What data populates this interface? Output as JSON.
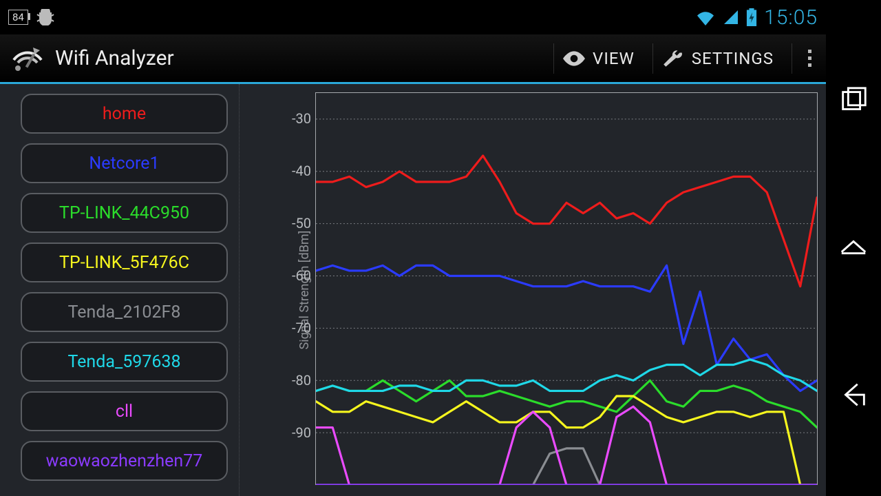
{
  "status": {
    "battery": "84",
    "clock": "15:05"
  },
  "app": {
    "title": "Wifi Analyzer"
  },
  "actions": {
    "view": "VIEW",
    "settings": "SETTINGS"
  },
  "networks": [
    {
      "name": "home",
      "color": "#ee1c1c"
    },
    {
      "name": "Netcore1",
      "color": "#2b3bff"
    },
    {
      "name": "TP-LINK_44C950",
      "color": "#2bdc2b"
    },
    {
      "name": "TP-LINK_5F476C",
      "color": "#f6f61e"
    },
    {
      "name": "Tenda_2102F8",
      "color": "#8a8d92"
    },
    {
      "name": "Tenda_597638",
      "color": "#1fd8e8"
    },
    {
      "name": "cll",
      "color": "#ea4bff"
    },
    {
      "name": "waowaozhenzhen77",
      "color": "#8b3bff"
    }
  ],
  "chart_data": {
    "type": "line",
    "ylabel": "Signal Strength [dBm]",
    "ylim": [
      -100,
      -25
    ],
    "yticks": [
      -30,
      -40,
      -50,
      -60,
      -70,
      -80,
      -90
    ],
    "x": [
      0,
      1,
      2,
      3,
      4,
      5,
      6,
      7,
      8,
      9,
      10,
      11,
      12,
      13,
      14,
      15,
      16,
      17,
      18,
      19,
      20,
      21,
      22,
      23,
      24,
      25,
      26,
      27,
      28,
      29,
      30
    ],
    "series": [
      {
        "name": "home",
        "color": "#ee1c1c",
        "values": [
          -42,
          -42,
          -41,
          -43,
          -42,
          -40,
          -42,
          -42,
          -42,
          -41,
          -37,
          -42,
          -48,
          -50,
          -50,
          -46,
          -48,
          -46,
          -49,
          -48,
          -50,
          -46,
          -44,
          -43,
          -42,
          -41,
          -41,
          -44,
          -53,
          -62,
          -45
        ]
      },
      {
        "name": "Netcore1",
        "color": "#2b3bff",
        "values": [
          -59,
          -58,
          -59,
          -59,
          -58,
          -60,
          -58,
          -58,
          -60,
          -60,
          -60,
          -60,
          -61,
          -62,
          -62,
          -62,
          -61,
          -62,
          -62,
          -62,
          -63,
          -58,
          -73,
          -63,
          -77,
          -72,
          -76,
          -75,
          -79,
          -82,
          -80
        ]
      },
      {
        "name": "TP-LINK_44C950",
        "color": "#2bdc2b",
        "values": [
          -82,
          -81,
          -82,
          -82,
          -80,
          -82,
          -84,
          -82,
          -80,
          -83,
          -83,
          -82,
          -83,
          -84,
          -85,
          -84,
          -84,
          -85,
          -86,
          -83,
          -80,
          -84,
          -85,
          -82,
          -82,
          -81,
          -82,
          -84,
          -85,
          -86,
          -89
        ]
      },
      {
        "name": "TP-LINK_5F476C",
        "color": "#f6f61e",
        "values": [
          -84,
          -86,
          -86,
          -84,
          -85,
          -86,
          -87,
          -88,
          -86,
          -84,
          -86,
          -88,
          -88,
          -86,
          -86,
          -89,
          -89,
          -87,
          -83,
          -83,
          -85,
          -87,
          -88,
          -87,
          -86,
          -86,
          -87,
          -86,
          -86,
          -100,
          -100
        ]
      },
      {
        "name": "Tenda_2102F8",
        "color": "#8a8d92",
        "values": [
          -100,
          -100,
          -100,
          -100,
          -100,
          -100,
          -100,
          -100,
          -100,
          -100,
          -100,
          -100,
          -100,
          -100,
          -94,
          -93,
          -93,
          -100,
          -100,
          -100,
          -100,
          -100,
          -100,
          -100,
          -100,
          -100,
          -100,
          -100,
          -100,
          -100,
          -100
        ]
      },
      {
        "name": "Tenda_597638",
        "color": "#1fd8e8",
        "values": [
          -82,
          -81,
          -82,
          -82,
          -82,
          -81,
          -81,
          -82,
          -82,
          -80,
          -80,
          -81,
          -81,
          -80,
          -82,
          -82,
          -82,
          -80,
          -79,
          -80,
          -78,
          -77,
          -77,
          -79,
          -77,
          -77,
          -76,
          -77,
          -79,
          -80,
          -82
        ]
      },
      {
        "name": "cll",
        "color": "#ea4bff",
        "values": [
          -89,
          -89,
          -100,
          -100,
          -100,
          -100,
          -100,
          -100,
          -100,
          -100,
          -100,
          -100,
          -89,
          -86,
          -89,
          -100,
          -100,
          -100,
          -87,
          -85,
          -88,
          -100,
          -100,
          -100,
          -100,
          -100,
          -100,
          -100,
          -100,
          -100,
          -100
        ]
      },
      {
        "name": "waowaozhenzhen77",
        "color": "#8b3bff",
        "values": [
          -100,
          -100,
          -100,
          -100,
          -100,
          -100,
          -100,
          -100,
          -100,
          -100,
          -100,
          -100,
          -100,
          -100,
          -100,
          -100,
          -100,
          -100,
          -100,
          -100,
          -100,
          -100,
          -100,
          -100,
          -100,
          -100,
          -100,
          -100,
          -100,
          -100,
          -100
        ]
      }
    ]
  }
}
